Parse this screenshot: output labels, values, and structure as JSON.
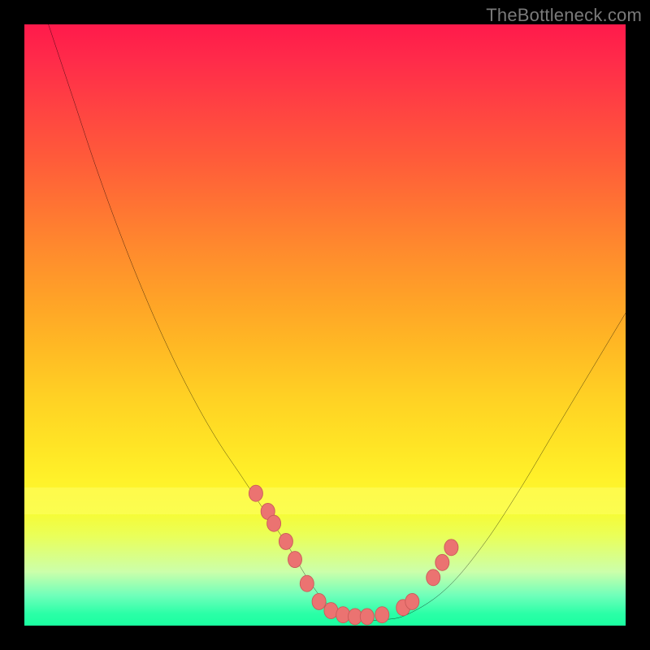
{
  "watermark": {
    "text": "TheBottleneck.com"
  },
  "colors": {
    "bg": "#000000",
    "curve_stroke": "#000000",
    "marker_fill": "#eb7371",
    "marker_stroke": "#c95a58"
  },
  "chart_data": {
    "type": "line",
    "title": "",
    "xlabel": "",
    "ylabel": "",
    "xlim": [
      0,
      100
    ],
    "ylim": [
      0,
      100
    ],
    "grid": false,
    "legend": false,
    "series": [
      {
        "name": "bottleneck-curve",
        "x": [
          4,
          8,
          12,
          16,
          20,
          24,
          28,
          32,
          36,
          40,
          44,
          47,
          50,
          53,
          56,
          60,
          64,
          70,
          76,
          82,
          88,
          94,
          100
        ],
        "y": [
          100,
          88,
          76,
          65,
          55,
          46,
          38,
          31,
          25,
          19,
          13,
          8,
          4,
          2,
          1,
          1,
          2,
          6,
          13,
          22,
          32,
          42,
          52
        ]
      }
    ],
    "markers": {
      "name": "highlighted-points",
      "x": [
        38.5,
        40.5,
        41.5,
        43.5,
        45.0,
        47.0,
        49.0,
        51.0,
        53.0,
        55.0,
        57.0,
        59.5,
        63.0,
        64.5,
        68.0,
        69.5,
        71.0
      ],
      "y": [
        22.0,
        19.0,
        17.0,
        14.0,
        11.0,
        7.0,
        4.0,
        2.5,
        1.8,
        1.5,
        1.5,
        1.8,
        3.0,
        4.0,
        8.0,
        10.5,
        13.0
      ]
    }
  }
}
